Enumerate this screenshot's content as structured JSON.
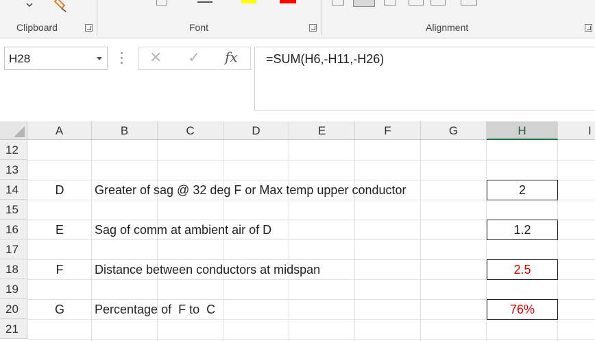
{
  "ribbon": {
    "groups": [
      {
        "label": "Clipboard"
      },
      {
        "label": "Font"
      },
      {
        "label": "Alignment"
      }
    ],
    "highlight_color": "#ffff00",
    "font_color": "#ff0000"
  },
  "formula_bar": {
    "name_box": "H28",
    "cancel_icon": "✕",
    "enter_icon": "✓",
    "fx_label": "fx",
    "formula": "=SUM(H6,-H11,-H26)"
  },
  "grid": {
    "columns": [
      "A",
      "B",
      "C",
      "D",
      "E",
      "F",
      "G",
      "H",
      "I"
    ],
    "selected_column": "H",
    "rows": [
      "12",
      "13",
      "14",
      "15",
      "16",
      "17",
      "18",
      "19",
      "20",
      "21"
    ],
    "entries": [
      {
        "row": "14",
        "letter": "D",
        "description": "Greater of sag @ 32 deg F or Max temp upper conductor",
        "value": "2"
      },
      {
        "row": "16",
        "letter": "E",
        "description": "Sag of comm at ambient air of D",
        "value": "1.2"
      },
      {
        "row": "18",
        "letter": "F",
        "description": "Distance between conductors at midspan",
        "value": "2.5"
      },
      {
        "row": "20",
        "letter": "G",
        "description": "Percentage of  F to  C",
        "value": "76%"
      }
    ],
    "value_color_red": "#e00000"
  }
}
